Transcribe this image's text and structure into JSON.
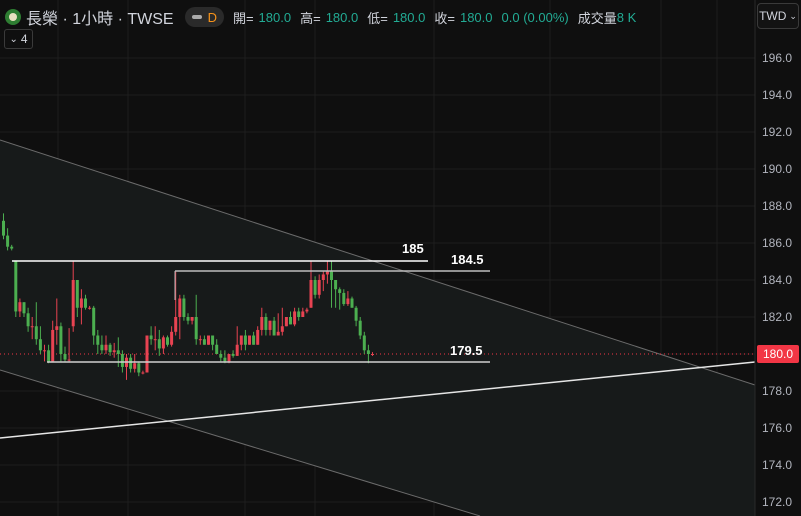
{
  "header": {
    "symbol_title": "長榮 · 1小時 · TWSE",
    "pill_letter": "D",
    "ohlc": [
      {
        "label": "開=",
        "value": "180.0"
      },
      {
        "label": "高=",
        "value": "180.0"
      },
      {
        "label": "低=",
        "value": "180.0"
      },
      {
        "label": "收=",
        "value": "180.0"
      }
    ],
    "change": "0.0 (0.00%)",
    "volume_label": "成交量",
    "volume_value": "8 K",
    "indicators_count": "4"
  },
  "currency": "TWD",
  "price_axis": [
    "196.0",
    "194.0",
    "192.0",
    "190.0",
    "188.0",
    "186.0",
    "184.0",
    "182.0",
    "180.0",
    "178.0",
    "176.0",
    "174.0",
    "172.0"
  ],
  "current_price": "180.0",
  "levels": {
    "top": "185",
    "mid": "184.5",
    "bottom": "179.5"
  },
  "colors": {
    "up": "#e84352",
    "down": "#4caf50",
    "price_tag": "#f23645",
    "value": "#22ab94"
  },
  "chart_data": {
    "type": "candlestick",
    "ylim": [
      171.5,
      197.5
    ],
    "ohlc": [
      [
        187.2,
        187.6,
        186.2,
        186.4
      ],
      [
        186.4,
        186.8,
        185.6,
        185.8
      ],
      [
        185.8,
        185.9,
        185.6,
        185.7
      ],
      [
        185,
        185,
        182,
        182.3
      ],
      [
        182.3,
        183,
        182,
        182.8
      ],
      [
        182.8,
        182.8,
        182,
        182.2
      ],
      [
        182.2,
        182.5,
        181.2,
        181.5
      ],
      [
        181.5,
        182,
        180.8,
        181.5
      ],
      [
        181.5,
        182.8,
        180.5,
        180.8
      ],
      [
        180.8,
        181.5,
        180,
        180.2
      ],
      [
        180.2,
        180.5,
        179.6,
        180.2
      ],
      [
        180.2,
        180.5,
        179.5,
        179.6
      ],
      [
        179.6,
        181.8,
        179.6,
        181.3
      ],
      [
        181.3,
        183,
        180.5,
        181.5
      ],
      [
        181.5,
        181.7,
        179.6,
        180
      ],
      [
        180,
        180.4,
        179.6,
        179.7
      ],
      [
        179.7,
        181.4,
        179.6,
        179.7
      ],
      [
        181.5,
        185,
        181.2,
        184
      ],
      [
        184,
        184,
        182,
        182.5
      ],
      [
        182.5,
        183.5,
        181.6,
        183
      ],
      [
        183,
        183.2,
        182.4,
        182.5
      ],
      [
        182.5,
        182.6,
        182.4,
        182.5
      ],
      [
        182.5,
        182.6,
        180.5,
        181
      ],
      [
        181,
        181.3,
        180,
        180.5
      ],
      [
        180.5,
        181,
        180,
        180.2
      ],
      [
        180.2,
        181,
        180,
        180.5
      ],
      [
        180.5,
        180.6,
        179.9,
        180.1
      ],
      [
        180.1,
        180.6,
        179.8,
        180.2
      ],
      [
        180.2,
        180.9,
        179.3,
        180
      ],
      [
        180,
        180.2,
        179,
        179.3
      ],
      [
        179.3,
        180,
        178.6,
        179.8
      ],
      [
        179.8,
        180,
        179,
        179.2
      ],
      [
        179.2,
        180,
        179,
        179.5
      ],
      [
        179.5,
        179.6,
        178.8,
        179
      ],
      [
        179,
        179.1,
        178.9,
        179
      ],
      [
        179,
        181,
        179,
        181
      ],
      [
        181,
        181.5,
        180.5,
        180.8
      ],
      [
        180.8,
        181.5,
        180.2,
        180.8
      ],
      [
        180.8,
        181.3,
        179.9,
        180.3
      ],
      [
        180.3,
        181,
        180,
        180.9
      ],
      [
        180.9,
        181,
        180.4,
        180.5
      ],
      [
        180.5,
        181.5,
        180.4,
        181.2
      ],
      [
        181.2,
        184.5,
        181,
        182
      ],
      [
        182,
        183.2,
        180.8,
        183
      ],
      [
        183,
        183.2,
        181.8,
        182
      ],
      [
        182,
        182.2,
        181.6,
        181.8
      ],
      [
        181.8,
        182,
        181.6,
        182
      ],
      [
        182,
        183.2,
        180.5,
        180.8
      ],
      [
        180.8,
        181,
        180.5,
        180.8
      ],
      [
        180.8,
        181,
        180.5,
        180.5
      ],
      [
        180.5,
        181,
        180.5,
        181
      ],
      [
        181,
        181,
        180.2,
        180.5
      ],
      [
        180.5,
        180.8,
        180,
        180
      ],
      [
        180,
        180.2,
        179.6,
        179.8
      ],
      [
        179.8,
        180.2,
        179.5,
        179.6
      ],
      [
        179.6,
        180,
        179.5,
        180
      ],
      [
        180,
        180.2,
        179.8,
        179.9
      ],
      [
        179.9,
        181.5,
        179.9,
        180.5
      ],
      [
        180.5,
        181,
        180.2,
        181
      ],
      [
        181,
        181.3,
        180.2,
        180.5
      ],
      [
        180.5,
        181,
        180.5,
        181
      ],
      [
        181,
        181.2,
        180.5,
        180.5
      ],
      [
        180.5,
        181.5,
        180.5,
        181.3
      ],
      [
        181.3,
        182.5,
        181,
        182
      ],
      [
        182,
        182.2,
        181,
        181.3
      ],
      [
        181.3,
        181.8,
        181,
        181.8
      ],
      [
        181.8,
        182,
        181,
        181
      ],
      [
        181,
        182.2,
        181,
        181.2
      ],
      [
        181.2,
        182.5,
        181,
        181.5
      ],
      [
        181.5,
        182,
        181.5,
        182
      ],
      [
        182,
        182.3,
        181.6,
        181.6
      ],
      [
        181.6,
        182.5,
        181.5,
        182.3
      ],
      [
        182.3,
        182.5,
        181.8,
        182
      ],
      [
        182,
        182.5,
        182,
        182.3
      ],
      [
        182.3,
        182.5,
        182.2,
        182.4
      ],
      [
        182.5,
        185,
        182.5,
        184
      ],
      [
        184,
        184.2,
        183,
        183.2
      ],
      [
        183.2,
        184.3,
        183,
        184
      ],
      [
        184,
        184.5,
        183.4,
        184.3
      ],
      [
        184.3,
        185,
        183.8,
        184.5
      ],
      [
        184.5,
        185,
        182.5,
        184
      ],
      [
        184,
        184,
        182.5,
        183.5
      ],
      [
        183.5,
        183.6,
        182.4,
        183.3
      ],
      [
        183.3,
        183.5,
        182.6,
        182.7
      ],
      [
        182.7,
        183.4,
        182.6,
        183
      ],
      [
        183,
        183.1,
        182.5,
        182.5
      ],
      [
        182.5,
        182.6,
        181.5,
        181.8
      ],
      [
        181.8,
        182,
        180.8,
        181
      ],
      [
        181,
        181.2,
        180,
        180.2
      ],
      [
        180.2,
        180.5,
        179.5,
        180
      ],
      [
        180,
        180.1,
        179.9,
        180
      ]
    ]
  }
}
